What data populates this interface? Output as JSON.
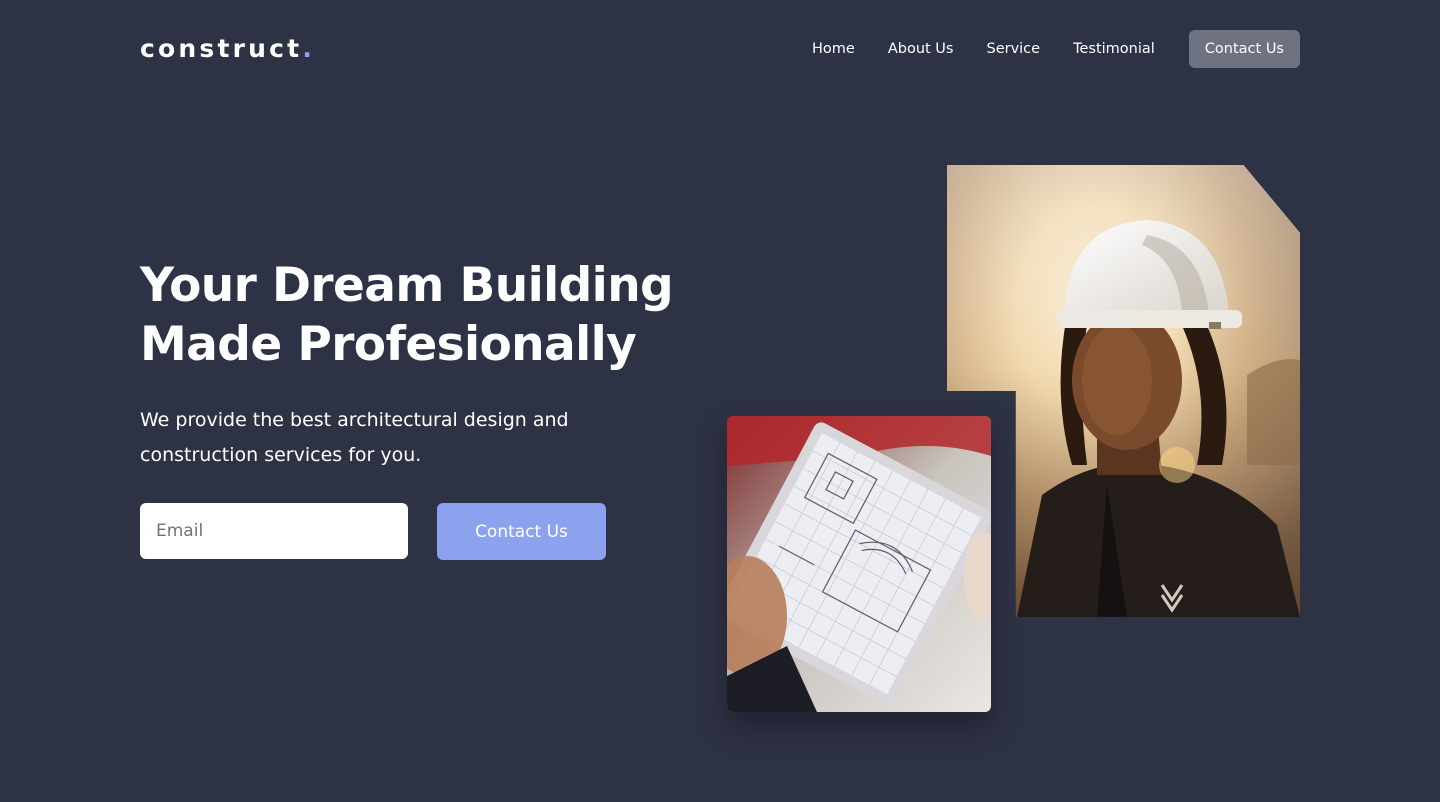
{
  "header": {
    "logo_text": "construct",
    "logo_dot": ".",
    "nav": [
      {
        "label": "Home"
      },
      {
        "label": "About Us"
      },
      {
        "label": "Service"
      },
      {
        "label": "Testimonial"
      }
    ],
    "cta_label": "Contact Us"
  },
  "hero": {
    "title_line1": "Your Dream Building",
    "title_line2": "Made Profesionally",
    "subtitle": "We provide the best architectural design and construction services for you.",
    "email_placeholder": "Email",
    "cta_label": "Contact Us"
  },
  "colors": {
    "background": "#2e3245",
    "accent": "#8da2ee",
    "nav_cta_bg": "#6f7380",
    "text": "#ffffff"
  },
  "images": {
    "worker": "photo-construction-worker-hard-hat",
    "sketch": "photo-clipboard-sketch"
  }
}
